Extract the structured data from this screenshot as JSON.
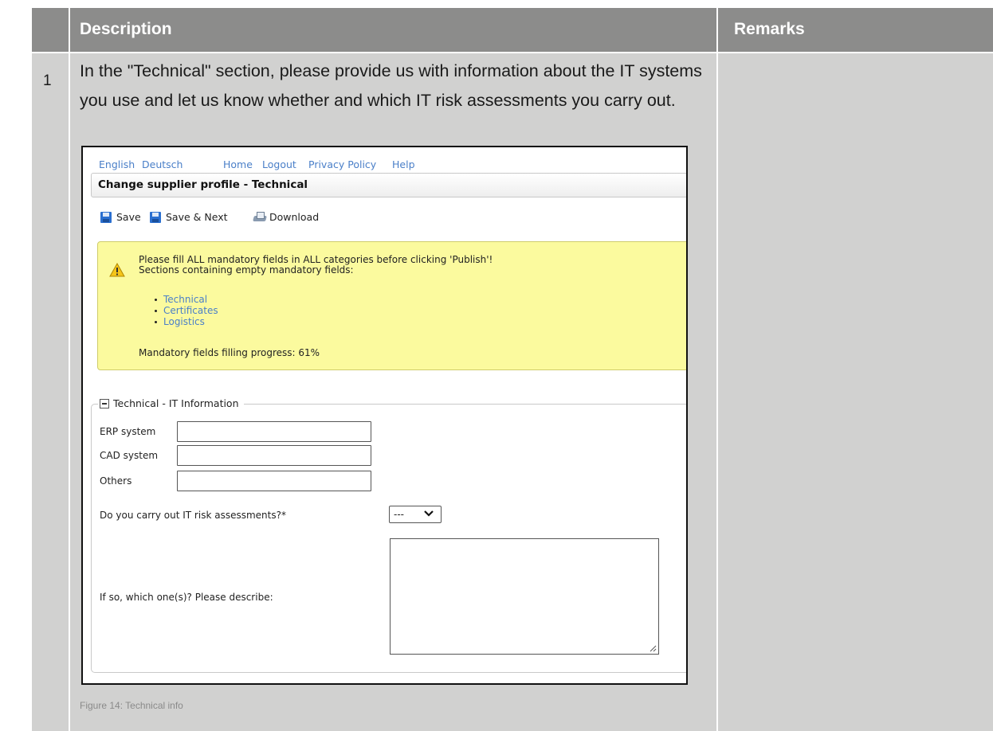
{
  "table": {
    "header": {
      "description": "Description",
      "remarks": "Remarks"
    },
    "row": {
      "number": "1",
      "description": "In the \"Technical\" section, please provide us with information about the IT systems you use and let us know whether and which IT risk assessments you carry out.",
      "caption": "Figure 14: Technical info",
      "remarks": ""
    }
  },
  "screenshot": {
    "nav": {
      "english": "English",
      "deutsch": "Deutsch",
      "home": "Home",
      "logout": "Logout",
      "privacy": "Privacy Policy",
      "help": "Help"
    },
    "title": "Change supplier profile - Technical",
    "toolbar": {
      "save": "Save",
      "save_next": "Save & Next",
      "download": "Download"
    },
    "warning": {
      "line1": "Please fill ALL mandatory fields in ALL categories before clicking 'Publish'!",
      "line2": "Sections containing empty mandatory fields:",
      "sections": [
        "Technical",
        "Certificates",
        "Logistics"
      ],
      "progress": "Mandatory fields filling progress: 61%"
    },
    "fieldset": {
      "legend": "Technical - IT Information",
      "erp_label": "ERP system",
      "erp_value": "",
      "cad_label": "CAD system",
      "cad_value": "",
      "others_label": "Others",
      "others_value": "",
      "risk_label": "Do you carry out IT risk assessments?*",
      "risk_value": "---",
      "describe_label": "If so, which one(s)? Please describe:",
      "describe_value": ""
    }
  },
  "colors": {
    "header_bg": "#8c8c8b",
    "cell_bg": "#d1d1d0",
    "link": "#4a7fc8",
    "warning_bg": "#fbfa9e"
  }
}
